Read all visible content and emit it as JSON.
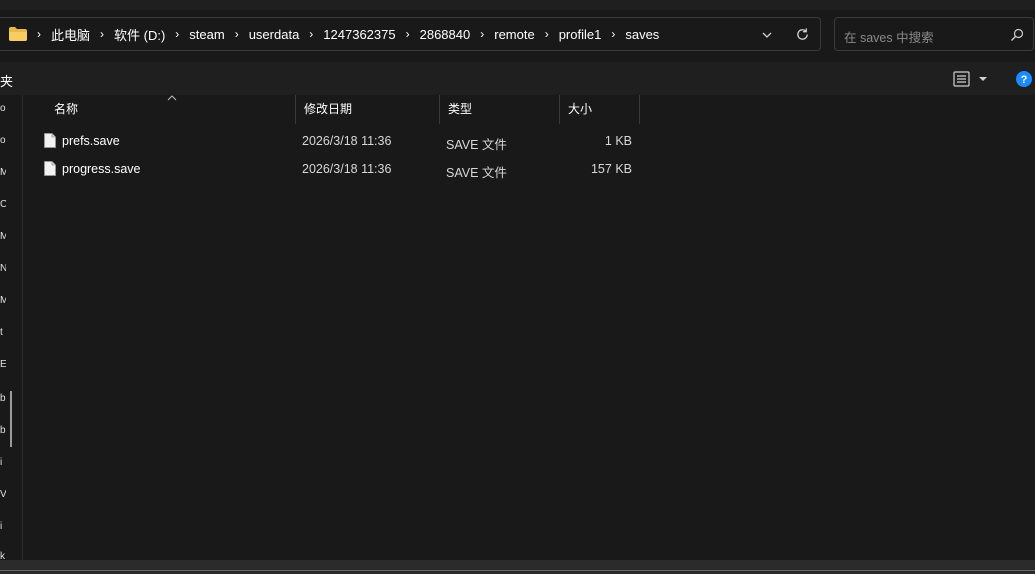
{
  "address": {
    "crumbs": [
      "此电脑",
      "软件 (D:)",
      "steam",
      "userdata",
      "1247362375",
      "2868840",
      "remote",
      "profile1",
      "saves"
    ]
  },
  "search": {
    "placeholder": "在 saves 中搜索"
  },
  "toolbar": {
    "left_fragment": "夹"
  },
  "nav": {
    "glyphs": [
      "o",
      "o",
      "M",
      "C",
      "M",
      "N",
      "M",
      "t",
      "E",
      "b",
      "b",
      "i",
      "V",
      "i",
      "k"
    ]
  },
  "columns": {
    "name": "名称",
    "date": "修改日期",
    "type": "类型",
    "size": "大小"
  },
  "files": [
    {
      "name": "prefs.save",
      "date": "2026/3/18 11:36",
      "type": "SAVE 文件",
      "size": "1 KB"
    },
    {
      "name": "progress.save",
      "date": "2026/3/18 11:36",
      "type": "SAVE 文件",
      "size": "157 KB"
    }
  ],
  "colors": {
    "background": "#191919",
    "accent": "#1a8cff",
    "folder": "#e8b84a"
  }
}
